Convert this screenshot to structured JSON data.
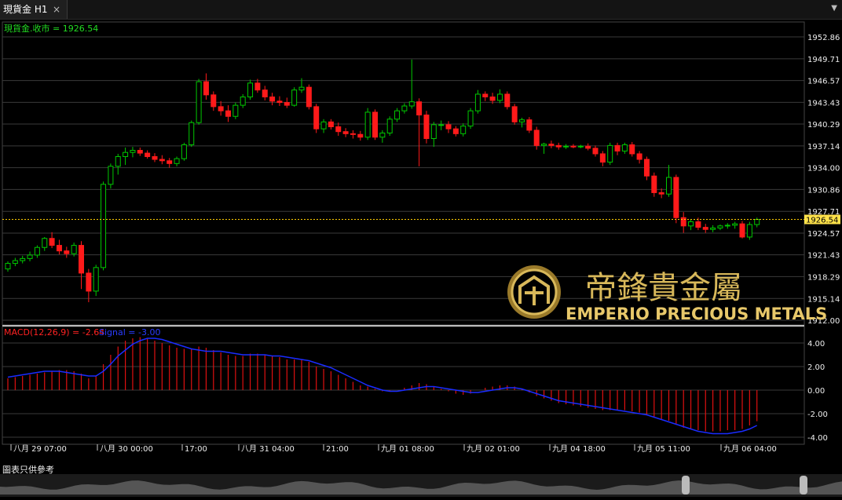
{
  "tab": {
    "title": "現貨金 H1",
    "close_icon": "×"
  },
  "menu_icon": "▼",
  "price_panel": {
    "label": "現貨金.收市 = 1926.54",
    "last_price": "1926.54",
    "y_ticks": [
      "1952.86",
      "1949.71",
      "1946.57",
      "1943.43",
      "1940.29",
      "1937.14",
      "1934.00",
      "1930.86",
      "1927.71",
      "1924.57",
      "1921.43",
      "1918.29",
      "1915.14",
      "1912.00"
    ]
  },
  "macd_panel": {
    "label_main": "MACD(12,26,9) = -2.64",
    "label_signal": "Signal = -3.00",
    "y_ticks": [
      "4.00",
      "2.00",
      "0.00",
      "-2.00",
      "-4.00"
    ]
  },
  "x_ticks": [
    "八月 29 07:00",
    "八月 30 00:00",
    "17:00",
    "八月 31 04:00",
    "21:00",
    "九月 01 08:00",
    "九月 02 01:00",
    "九月 04 18:00",
    "九月 05 11:00",
    "九月 06 04:00"
  ],
  "watermark": {
    "chinese": "帝鋒貴金屬",
    "english": "EMPERIO PRECIOUS METALS"
  },
  "footer": {
    "disclaimer": "圖表只供參考"
  },
  "colors": {
    "up": "#00c800",
    "down": "#ff1a1a",
    "macd_hist": "#e01010",
    "signal": "#1a2cff",
    "grid": "#3a3a3a",
    "last_line": "#ffcc00",
    "gold": "#c8a84a"
  },
  "chart_data": {
    "type": "candlestick",
    "price_axis": {
      "min": 1912.0,
      "max": 1952.86
    },
    "macd_axis": {
      "min": -4.0,
      "max": 4.0
    },
    "candles_ohlc": [
      [
        1919.4,
        1920.5,
        1919.0,
        1920.2
      ],
      [
        1920.2,
        1921.0,
        1919.8,
        1920.6
      ],
      [
        1920.6,
        1921.3,
        1920.2,
        1920.9
      ],
      [
        1920.9,
        1921.9,
        1920.5,
        1921.4
      ],
      [
        1921.4,
        1922.8,
        1921.0,
        1922.5
      ],
      [
        1922.5,
        1924.0,
        1922.0,
        1923.8
      ],
      [
        1923.8,
        1924.7,
        1922.4,
        1922.8
      ],
      [
        1922.8,
        1923.6,
        1921.5,
        1922.0
      ],
      [
        1922.0,
        1922.6,
        1921.0,
        1921.6
      ],
      [
        1921.6,
        1923.2,
        1921.2,
        1922.8
      ],
      [
        1922.8,
        1923.4,
        1916.5,
        1918.8
      ],
      [
        1918.8,
        1919.4,
        1914.6,
        1916.2
      ],
      [
        1916.2,
        1920.0,
        1915.5,
        1919.6
      ],
      [
        1919.6,
        1932.0,
        1919.2,
        1931.6
      ],
      [
        1931.6,
        1934.6,
        1931.0,
        1934.2
      ],
      [
        1934.2,
        1936.0,
        1933.0,
        1935.6
      ],
      [
        1935.6,
        1936.9,
        1934.4,
        1936.2
      ],
      [
        1936.2,
        1937.0,
        1935.5,
        1936.5
      ],
      [
        1936.5,
        1936.9,
        1935.7,
        1936.1
      ],
      [
        1936.1,
        1936.5,
        1935.3,
        1935.6
      ],
      [
        1935.6,
        1936.1,
        1934.8,
        1935.2
      ],
      [
        1935.2,
        1935.8,
        1934.5,
        1935.0
      ],
      [
        1935.0,
        1935.4,
        1934.0,
        1934.6
      ],
      [
        1934.6,
        1935.6,
        1934.2,
        1935.3
      ],
      [
        1935.3,
        1937.6,
        1935.0,
        1937.3
      ],
      [
        1937.3,
        1940.8,
        1937.0,
        1940.5
      ],
      [
        1940.5,
        1946.8,
        1940.2,
        1946.4
      ],
      [
        1946.4,
        1947.6,
        1943.8,
        1944.5
      ],
      [
        1944.5,
        1945.0,
        1942.2,
        1942.8
      ],
      [
        1942.8,
        1943.6,
        1941.5,
        1942.2
      ],
      [
        1942.2,
        1943.0,
        1940.6,
        1941.4
      ],
      [
        1941.4,
        1943.4,
        1941.0,
        1943.0
      ],
      [
        1943.0,
        1944.6,
        1942.6,
        1944.2
      ],
      [
        1944.2,
        1946.7,
        1943.8,
        1946.2
      ],
      [
        1946.2,
        1946.8,
        1944.8,
        1945.2
      ],
      [
        1945.2,
        1945.8,
        1943.7,
        1944.2
      ],
      [
        1944.2,
        1944.8,
        1943.0,
        1943.6
      ],
      [
        1943.6,
        1944.3,
        1942.9,
        1943.4
      ],
      [
        1943.4,
        1944.1,
        1942.6,
        1943.0
      ],
      [
        1943.0,
        1945.6,
        1942.8,
        1945.2
      ],
      [
        1945.2,
        1946.9,
        1944.8,
        1945.6
      ],
      [
        1945.6,
        1946.0,
        1942.4,
        1942.8
      ],
      [
        1942.8,
        1943.2,
        1939.0,
        1939.6
      ],
      [
        1939.6,
        1941.0,
        1939.0,
        1940.6
      ],
      [
        1940.6,
        1941.0,
        1939.5,
        1939.9
      ],
      [
        1939.9,
        1940.5,
        1938.6,
        1939.2
      ],
      [
        1939.2,
        1939.7,
        1938.4,
        1938.9
      ],
      [
        1938.9,
        1939.4,
        1938.2,
        1938.8
      ],
      [
        1938.8,
        1939.3,
        1937.9,
        1938.4
      ],
      [
        1938.4,
        1942.6,
        1938.0,
        1942.0
      ],
      [
        1942.0,
        1942.4,
        1938.0,
        1938.4
      ],
      [
        1938.4,
        1939.4,
        1937.6,
        1939.0
      ],
      [
        1939.0,
        1941.4,
        1938.6,
        1941.0
      ],
      [
        1941.0,
        1942.6,
        1940.6,
        1942.2
      ],
      [
        1942.2,
        1943.3,
        1941.8,
        1942.9
      ],
      [
        1942.9,
        1949.6,
        1942.5,
        1943.5
      ],
      [
        1943.5,
        1944.0,
        1934.2,
        1941.6
      ],
      [
        1941.6,
        1942.2,
        1937.5,
        1938.2
      ],
      [
        1938.2,
        1940.6,
        1937.0,
        1940.2
      ],
      [
        1940.2,
        1940.8,
        1939.4,
        1940.2
      ],
      [
        1940.2,
        1940.7,
        1939.0,
        1939.6
      ],
      [
        1939.6,
        1940.0,
        1938.5,
        1938.9
      ],
      [
        1938.9,
        1940.4,
        1938.5,
        1940.0
      ],
      [
        1940.0,
        1942.6,
        1939.6,
        1942.2
      ],
      [
        1942.2,
        1945.2,
        1941.8,
        1944.6
      ],
      [
        1944.6,
        1945.0,
        1943.6,
        1944.2
      ],
      [
        1944.2,
        1944.8,
        1943.2,
        1943.7
      ],
      [
        1943.7,
        1945.3,
        1943.3,
        1944.6
      ],
      [
        1944.6,
        1945.0,
        1942.4,
        1942.8
      ],
      [
        1942.8,
        1943.2,
        1940.2,
        1940.6
      ],
      [
        1940.6,
        1941.2,
        1939.8,
        1940.9
      ],
      [
        1940.9,
        1941.3,
        1939.0,
        1939.4
      ],
      [
        1939.4,
        1939.9,
        1936.6,
        1937.2
      ],
      [
        1937.2,
        1937.6,
        1936.0,
        1937.4
      ],
      [
        1937.4,
        1937.9,
        1936.8,
        1937.2
      ],
      [
        1937.2,
        1937.6,
        1936.6,
        1937.0
      ],
      [
        1937.0,
        1937.4,
        1936.7,
        1937.1
      ],
      [
        1937.1,
        1937.4,
        1936.8,
        1937.0
      ],
      [
        1937.0,
        1937.3,
        1936.8,
        1937.1
      ],
      [
        1937.1,
        1937.5,
        1936.5,
        1936.8
      ],
      [
        1936.8,
        1937.2,
        1935.6,
        1936.0
      ],
      [
        1936.0,
        1936.4,
        1934.2,
        1934.8
      ],
      [
        1934.8,
        1937.6,
        1934.4,
        1937.2
      ],
      [
        1937.2,
        1937.6,
        1935.8,
        1936.4
      ],
      [
        1936.4,
        1937.6,
        1936.0,
        1937.3
      ],
      [
        1937.3,
        1937.7,
        1935.6,
        1936.0
      ],
      [
        1936.0,
        1936.4,
        1934.6,
        1935.2
      ],
      [
        1935.2,
        1935.6,
        1932.2,
        1932.8
      ],
      [
        1932.8,
        1933.3,
        1929.8,
        1930.4
      ],
      [
        1930.4,
        1931.0,
        1929.6,
        1930.2
      ],
      [
        1930.2,
        1934.4,
        1929.8,
        1932.6
      ],
      [
        1932.6,
        1933.0,
        1926.0,
        1926.8
      ],
      [
        1926.8,
        1927.6,
        1924.6,
        1925.6
      ],
      [
        1925.6,
        1926.6,
        1925.0,
        1926.2
      ],
      [
        1926.2,
        1926.8,
        1925.0,
        1925.4
      ],
      [
        1925.4,
        1925.9,
        1924.6,
        1925.1
      ],
      [
        1925.1,
        1925.7,
        1924.7,
        1925.3
      ],
      [
        1925.3,
        1925.8,
        1925.0,
        1925.6
      ],
      [
        1925.6,
        1926.0,
        1925.2,
        1925.7
      ],
      [
        1925.7,
        1926.2,
        1925.2,
        1925.9
      ],
      [
        1925.9,
        1926.3,
        1923.8,
        1924.0
      ],
      [
        1924.0,
        1926.2,
        1923.6,
        1925.8
      ],
      [
        1925.8,
        1926.8,
        1925.4,
        1926.54
      ]
    ],
    "macd_histogram": [
      1.0,
      1.1,
      1.2,
      1.3,
      1.4,
      1.5,
      1.6,
      1.7,
      1.7,
      1.6,
      1.4,
      1.0,
      1.2,
      2.2,
      3.0,
      3.7,
      4.2,
      4.4,
      4.5,
      4.4,
      4.2,
      4.0,
      3.8,
      3.6,
      3.5,
      3.5,
      3.7,
      3.6,
      3.4,
      3.2,
      3.0,
      2.9,
      2.9,
      3.1,
      3.1,
      3.0,
      2.9,
      2.8,
      2.6,
      2.6,
      2.6,
      2.4,
      2.0,
      1.8,
      1.6,
      1.3,
      1.0,
      0.7,
      0.4,
      0.3,
      0.1,
      -0.1,
      -0.1,
      0.0,
      0.2,
      0.4,
      0.6,
      0.5,
      0.3,
      0.1,
      -0.1,
      -0.3,
      -0.4,
      -0.3,
      0.0,
      0.2,
      0.3,
      0.4,
      0.4,
      0.3,
      0.1,
      -0.2,
      -0.5,
      -0.7,
      -0.9,
      -1.1,
      -1.2,
      -1.3,
      -1.4,
      -1.5,
      -1.6,
      -1.7,
      -1.7,
      -1.7,
      -1.7,
      -1.8,
      -1.9,
      -2.1,
      -2.3,
      -2.5,
      -2.6,
      -2.9,
      -3.2,
      -3.3,
      -3.4,
      -3.5,
      -3.5,
      -3.5,
      -3.4,
      -3.4,
      -3.3,
      -3.0,
      -2.64
    ],
    "signal": [
      1.1,
      1.2,
      1.3,
      1.4,
      1.5,
      1.6,
      1.6,
      1.6,
      1.5,
      1.4,
      1.3,
      1.2,
      1.2,
      1.6,
      2.2,
      2.9,
      3.4,
      3.9,
      4.2,
      4.4,
      4.4,
      4.3,
      4.1,
      3.9,
      3.7,
      3.5,
      3.4,
      3.3,
      3.3,
      3.3,
      3.2,
      3.1,
      3.0,
      3.0,
      3.0,
      3.0,
      2.9,
      2.9,
      2.8,
      2.7,
      2.6,
      2.5,
      2.3,
      2.1,
      1.9,
      1.6,
      1.3,
      1.0,
      0.7,
      0.4,
      0.2,
      0.0,
      -0.1,
      -0.1,
      0.0,
      0.1,
      0.2,
      0.3,
      0.3,
      0.2,
      0.1,
      0.0,
      -0.1,
      -0.2,
      -0.2,
      -0.1,
      0.0,
      0.1,
      0.2,
      0.2,
      0.1,
      -0.1,
      -0.3,
      -0.5,
      -0.7,
      -0.9,
      -1.0,
      -1.1,
      -1.2,
      -1.3,
      -1.4,
      -1.5,
      -1.6,
      -1.7,
      -1.8,
      -1.9,
      -2.0,
      -2.1,
      -2.3,
      -2.5,
      -2.7,
      -2.9,
      -3.1,
      -3.3,
      -3.5,
      -3.6,
      -3.7,
      -3.7,
      -3.7,
      -3.6,
      -3.5,
      -3.3,
      -3.0
    ]
  }
}
